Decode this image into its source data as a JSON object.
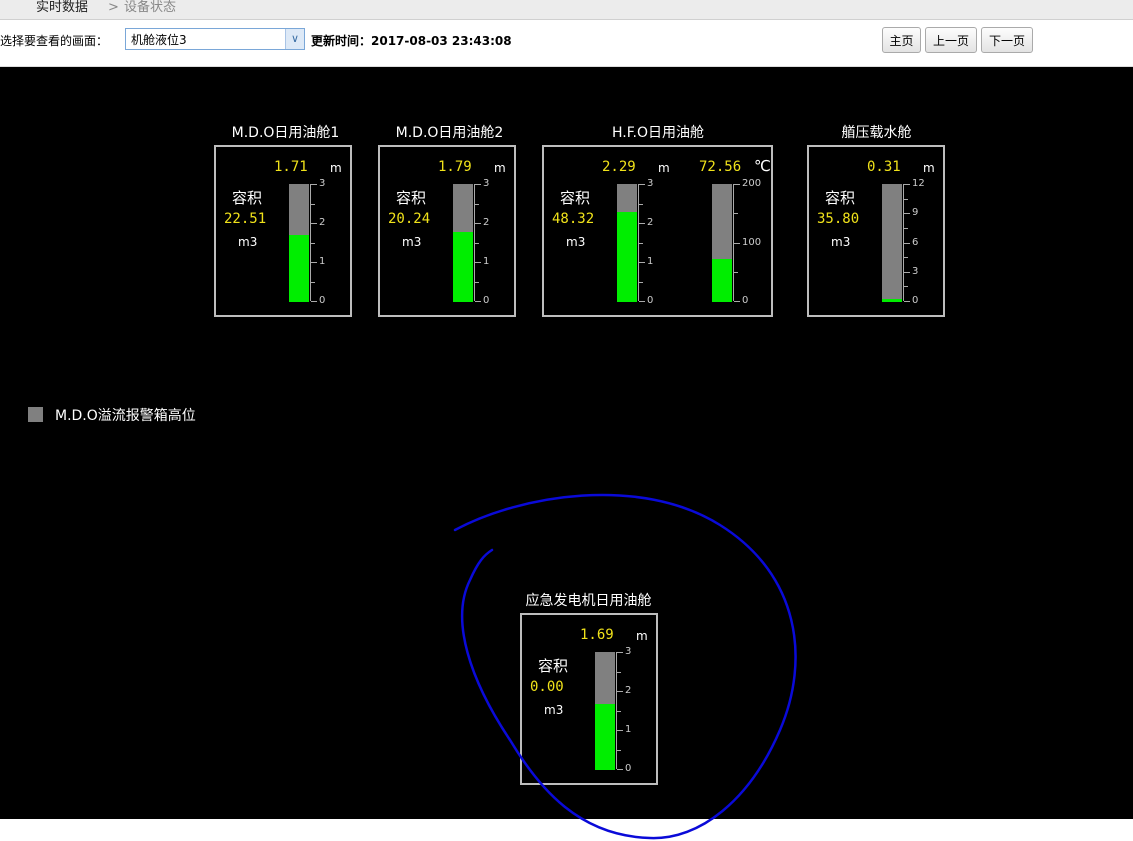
{
  "breadcrumb": {
    "home": "实时数据",
    "separator": ">",
    "current": "设备状态"
  },
  "toolbar": {
    "select_label": "选择要查看的画面：",
    "select_value": "机舱液位3",
    "update_label": "更新时间：2017-08-03 23:43:08",
    "btn_home": "主页",
    "btn_prev": "上一页",
    "btn_next": "下一页"
  },
  "tanks": [
    {
      "title": "M.D.O日用油舱1",
      "level": "1.71",
      "level_unit": "m",
      "vol_label": "容积",
      "volume": "22.51",
      "vol_unit": "m3",
      "scale": [
        "3",
        "2",
        "1",
        "0"
      ],
      "fill": 0.57
    },
    {
      "title": "M.D.O日用油舱2",
      "level": "1.79",
      "level_unit": "m",
      "vol_label": "容积",
      "volume": "20.24",
      "vol_unit": "m3",
      "scale": [
        "3",
        "2",
        "1",
        "0"
      ],
      "fill": 0.597
    },
    {
      "title": "H.F.O日用油舱",
      "level": "2.29",
      "level_unit": "m",
      "vol_label": "容积",
      "volume": "48.32",
      "vol_unit": "m3",
      "scale": [
        "3",
        "2",
        "1",
        "0"
      ],
      "fill": 0.763,
      "temp": "72.56",
      "temp_unit": "℃",
      "temp_scale": [
        "200",
        "100",
        "0"
      ],
      "temp_fill": 0.363
    },
    {
      "title": "艏压载水舱",
      "level": "0.31",
      "level_unit": "m",
      "vol_label": "容积",
      "volume": "35.80",
      "vol_unit": "m3",
      "scale": [
        "12",
        "9",
        "6",
        "3",
        "0"
      ],
      "fill": 0.026
    },
    {
      "title": "应急发电机日用油舱",
      "level": "1.69",
      "level_unit": "m",
      "vol_label": "容积",
      "volume": "0.00",
      "vol_unit": "m3",
      "scale": [
        "3",
        "2",
        "1",
        "0"
      ],
      "fill": 0.563
    }
  ],
  "alarm": {
    "label": "M.D.O溢流报警箱高位",
    "color": "#808080"
  },
  "colors": {
    "fill": "#00ee00",
    "empty": "#808080",
    "value": "#f0e21a",
    "annotation": "#0a0ad8"
  }
}
